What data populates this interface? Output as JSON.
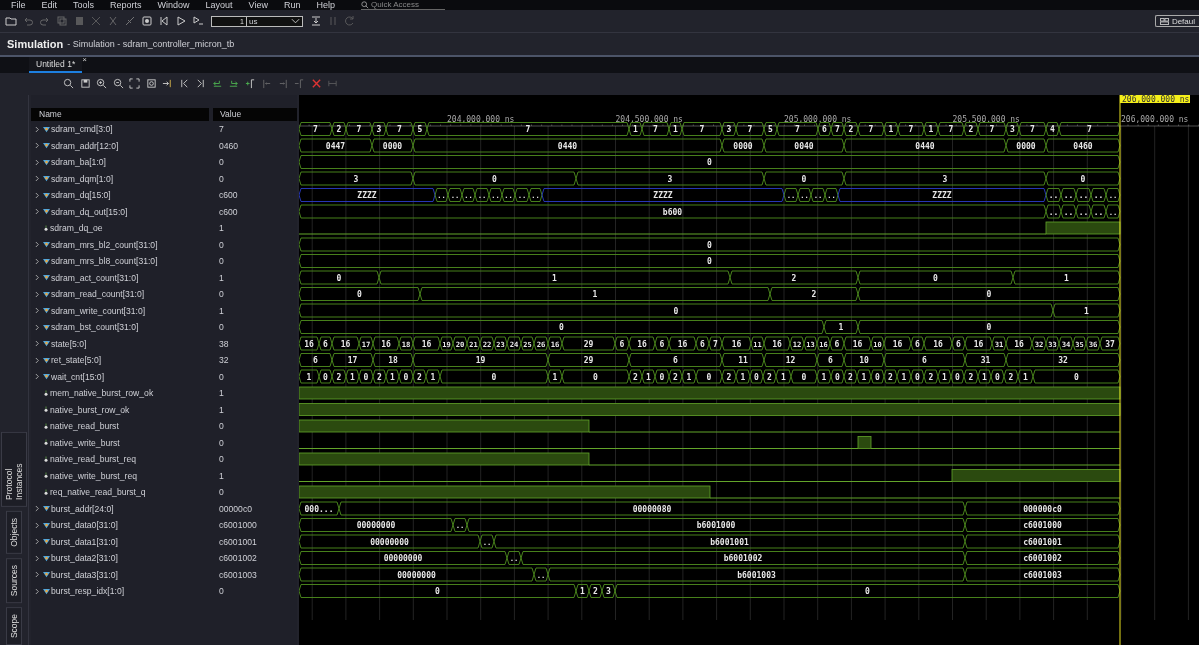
{
  "menu": [
    "File",
    "Edit",
    "Tools",
    "Reports",
    "Window",
    "Layout",
    "View",
    "Run",
    "Help"
  ],
  "quick_access": {
    "placeholder": "Quick Access"
  },
  "toolbar": {
    "time_value": "1",
    "time_unit": "us",
    "layout_button": "Defaul"
  },
  "title": {
    "main": "Simulation",
    "subtitle": "- Simulation - sdram_controller_micron_tb"
  },
  "tabs": [
    {
      "label": "Untitled 1*",
      "selected": true,
      "close": "×"
    }
  ],
  "columns": [
    "Name",
    "Value"
  ],
  "ruler": [
    "204,000.000 ns",
    "204,500.000 ns",
    "205,000.000 ns",
    "205,500.000 ns",
    "206,000.000 ns"
  ],
  "cursor": {
    "label": "206,000.000 ns"
  },
  "signals": [
    {
      "name": "sdram_cmd[3:0]",
      "kind": "bus",
      "value": "7",
      "segments": [
        "7",
        "2",
        "7",
        "3",
        "7",
        "5",
        "7",
        "1",
        "7",
        "1",
        "7",
        "3",
        "7",
        "5",
        "7",
        "6",
        "7",
        "2",
        "7",
        "1",
        "7",
        "1",
        "7",
        "2",
        "7",
        "3",
        "7",
        "4",
        "7"
      ]
    },
    {
      "name": "sdram_addr[12:0]",
      "kind": "bus",
      "value": "0460",
      "segments": [
        "0447",
        "0000",
        "0440",
        "0000",
        "0040",
        "0440",
        "0000",
        "0460"
      ]
    },
    {
      "name": "sdram_ba[1:0]",
      "kind": "bus",
      "value": "0",
      "segments": [
        "0"
      ]
    },
    {
      "name": "sdram_dqm[1:0]",
      "kind": "bus",
      "value": "0",
      "segments": [
        "3",
        "0",
        "3",
        "0",
        "3",
        "0"
      ]
    },
    {
      "name": "sdram_dq[15:0]",
      "kind": "bus",
      "value": "c600",
      "segments": [
        {
          "value": "ZZZZ",
          "highz": true
        },
        {
          "value": ".."
        },
        {
          "value": ".."
        },
        {
          "value": ".."
        },
        {
          "value": ".."
        },
        {
          "value": ".."
        },
        {
          "value": ".."
        },
        {
          "value": ".."
        },
        {
          "value": ".."
        },
        {
          "value": "ZZZZ",
          "highz": true
        },
        {
          "value": ".."
        },
        {
          "value": ".."
        },
        {
          "value": ".."
        },
        {
          "value": ".."
        },
        {
          "value": "ZZZZ",
          "highz": true
        },
        {
          "value": ".."
        },
        {
          "value": ".."
        },
        {
          "value": ".."
        },
        {
          "value": ".."
        },
        {
          "value": ".."
        }
      ]
    },
    {
      "name": "sdram_dq_out[15:0]",
      "kind": "bus",
      "value": "c600",
      "segments": [
        "b600",
        "..",
        "..",
        "..",
        "..",
        ".."
      ]
    },
    {
      "name": "sdram_dq_oe",
      "kind": "bit",
      "value": "1",
      "segments": [
        {
          "high": false
        },
        {
          "high": true
        }
      ]
    },
    {
      "name": "sdram_mrs_bl2_count[31:0]",
      "kind": "bus",
      "value": "0",
      "segments": [
        "0"
      ]
    },
    {
      "name": "sdram_mrs_bl8_count[31:0]",
      "kind": "bus",
      "value": "0",
      "segments": [
        "0"
      ]
    },
    {
      "name": "sdram_act_count[31:0]",
      "kind": "bus",
      "value": "1",
      "segments": [
        "0",
        "1",
        "2",
        "0",
        "1"
      ]
    },
    {
      "name": "sdram_read_count[31:0]",
      "kind": "bus",
      "value": "0",
      "segments": [
        "0",
        "1",
        "2",
        "0"
      ]
    },
    {
      "name": "sdram_write_count[31:0]",
      "kind": "bus",
      "value": "1",
      "segments": [
        "0",
        "1"
      ]
    },
    {
      "name": "sdram_bst_count[31:0]",
      "kind": "bus",
      "value": "0",
      "segments": [
        "0",
        "1",
        "0"
      ]
    },
    {
      "name": "state[5:0]",
      "kind": "bus",
      "value": "38",
      "segments": [
        "16",
        "6",
        "16",
        "17",
        "16",
        "18",
        "16",
        "19",
        "20",
        "21",
        "22",
        "23",
        "24",
        "25",
        "26",
        "16",
        "29",
        "6",
        "16",
        "6",
        "16",
        "6",
        "7",
        "16",
        "11",
        "16",
        "12",
        "13",
        "16",
        "6",
        "16",
        "10",
        "16",
        "6",
        "16",
        "6",
        "16",
        "31",
        "16",
        "32",
        "33",
        "34",
        "35",
        "36",
        "37"
      ]
    },
    {
      "name": "ret_state[5:0]",
      "kind": "bus",
      "value": "32",
      "segments": [
        "6",
        "17",
        "18",
        "19",
        "29",
        "6",
        "11",
        "12",
        "6",
        "10",
        "6",
        "31",
        "32"
      ]
    },
    {
      "name": "wait_cnt[15:0]",
      "kind": "bus",
      "value": "0",
      "segments": [
        "1",
        "0",
        "2",
        "1",
        "0",
        "2",
        "1",
        "0",
        "2",
        "1",
        "0",
        "1",
        "0",
        "2",
        "1",
        "0",
        "2",
        "1",
        "0",
        "2",
        "1",
        "0",
        "2",
        "1",
        "0",
        "1",
        "0",
        "2",
        "1",
        "0",
        "2",
        "1",
        "0",
        "2",
        "1",
        "0",
        "2",
        "1",
        "0",
        "2",
        "1",
        "0"
      ]
    },
    {
      "name": "mem_native_burst_row_ok",
      "kind": "bit",
      "value": "1",
      "segments": [
        {
          "high": true
        }
      ]
    },
    {
      "name": "native_burst_row_ok",
      "kind": "bit",
      "value": "1",
      "segments": [
        {
          "high": true
        }
      ]
    },
    {
      "name": "native_read_burst",
      "kind": "bit",
      "value": "0",
      "segments": [
        {
          "high": true
        },
        {
          "high": false
        }
      ]
    },
    {
      "name": "native_write_burst",
      "kind": "bit",
      "value": "0",
      "segments": [
        {
          "high": false
        },
        {
          "high": true
        },
        {
          "high": false
        }
      ]
    },
    {
      "name": "native_read_burst_req",
      "kind": "bit",
      "value": "0",
      "segments": [
        {
          "high": true
        },
        {
          "high": false
        }
      ]
    },
    {
      "name": "native_write_burst_req",
      "kind": "bit",
      "value": "1",
      "segments": [
        {
          "high": false
        },
        {
          "high": true
        }
      ]
    },
    {
      "name": "req_native_read_burst_q",
      "kind": "bit",
      "value": "0",
      "segments": [
        {
          "high": true
        },
        {
          "high": false
        }
      ]
    },
    {
      "name": "burst_addr[24:0]",
      "kind": "bus",
      "value": "00000c0",
      "segments": [
        "000...",
        "00000080",
        "000000c0"
      ]
    },
    {
      "name": "burst_data0[31:0]",
      "kind": "bus",
      "value": "c6001000",
      "segments": [
        "00000000",
        "..",
        "b6001000",
        "c6001000"
      ]
    },
    {
      "name": "burst_data1[31:0]",
      "kind": "bus",
      "value": "c6001001",
      "segments": [
        "00000000",
        "..",
        "b6001001",
        "c6001001"
      ]
    },
    {
      "name": "burst_data2[31:0]",
      "kind": "bus",
      "value": "c6001002",
      "segments": [
        "00000000",
        "..",
        "b6001002",
        "c6001002"
      ]
    },
    {
      "name": "burst_data3[31:0]",
      "kind": "bus",
      "value": "c6001003",
      "segments": [
        "00000000",
        "..",
        "b6001003",
        "c6001003"
      ]
    },
    {
      "name": "burst_resp_idx[1:0]",
      "kind": "bus",
      "value": "0",
      "segments": [
        "0",
        "1",
        "2",
        "3",
        "0"
      ]
    }
  ],
  "side_tabs": [
    "Protocol Instances",
    "Objects",
    "Sources",
    "Scope"
  ]
}
